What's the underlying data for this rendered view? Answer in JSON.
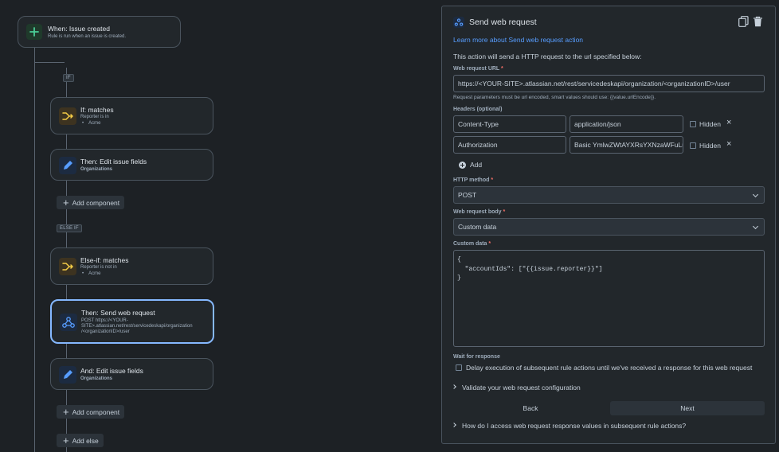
{
  "flow": {
    "trigger": {
      "title": "When: Issue created",
      "subtitle": "Rule is run when an issue is created."
    },
    "if_tag": "IF",
    "if_node": {
      "title": "If: matches",
      "subtitle": "Reporter is in",
      "values": [
        "Acme"
      ]
    },
    "then_edit": {
      "title": "Then: Edit issue fields",
      "subtitle": "Organizations"
    },
    "add_component_label": "Add component",
    "else_if_tag": "ELSE IF",
    "else_if_node": {
      "title": "Else-if: matches",
      "subtitle": "Reporter is not in",
      "values": [
        "Acme"
      ]
    },
    "then_send": {
      "title": "Then: Send web request",
      "lines": [
        "POST https://<YOUR-",
        "SITE>.atlassian.net/rest/servicedeskapi/organization",
        "/<organizationID>/user"
      ]
    },
    "and_edit": {
      "title": "And: Edit issue fields",
      "subtitle": "Organizations"
    },
    "add_else_label": "Add else"
  },
  "panel": {
    "title": "Send web request",
    "learn_more": "Learn more about Send web request action",
    "description": "This action will send a HTTP request to the url specified below:",
    "url_label": "Web request URL",
    "url_value": "https://<YOUR-SITE>.atlassian.net/rest/servicedeskapi/organization/<organizationID>/user",
    "url_help": "Request parameters must be url encoded, smart values should use: {{value.urlEncode}}.",
    "headers_label": "Headers (optional)",
    "headers": [
      {
        "name": "Content-Type",
        "value": "application/json",
        "hidden_label": "Hidden"
      },
      {
        "name": "Authorization",
        "value": "Basic YmlwZWtAYXRsYXNzaWFuLm",
        "hidden_label": "Hidden"
      }
    ],
    "add_label": "Add",
    "method_label": "HTTP method",
    "method_value": "POST",
    "body_label": "Web request body",
    "body_value": "Custom data",
    "custom_label": "Custom data",
    "custom_value": "{\n  \"accountIds\": [\"{{issue.reporter}}\"]\n}",
    "wait_label": "Wait for response",
    "wait_checkbox": "Delay execution of subsequent rule actions until we've received a response for this web request",
    "validate": "Validate your web request configuration",
    "back_label": "Back",
    "next_label": "Next",
    "faq": "How do I access web request response values in subsequent rule actions?"
  },
  "colors": {
    "accent": "#579dff",
    "required": "#f87168",
    "condition_icon": "#f5cd47",
    "trigger_icon": "#4bce97"
  }
}
